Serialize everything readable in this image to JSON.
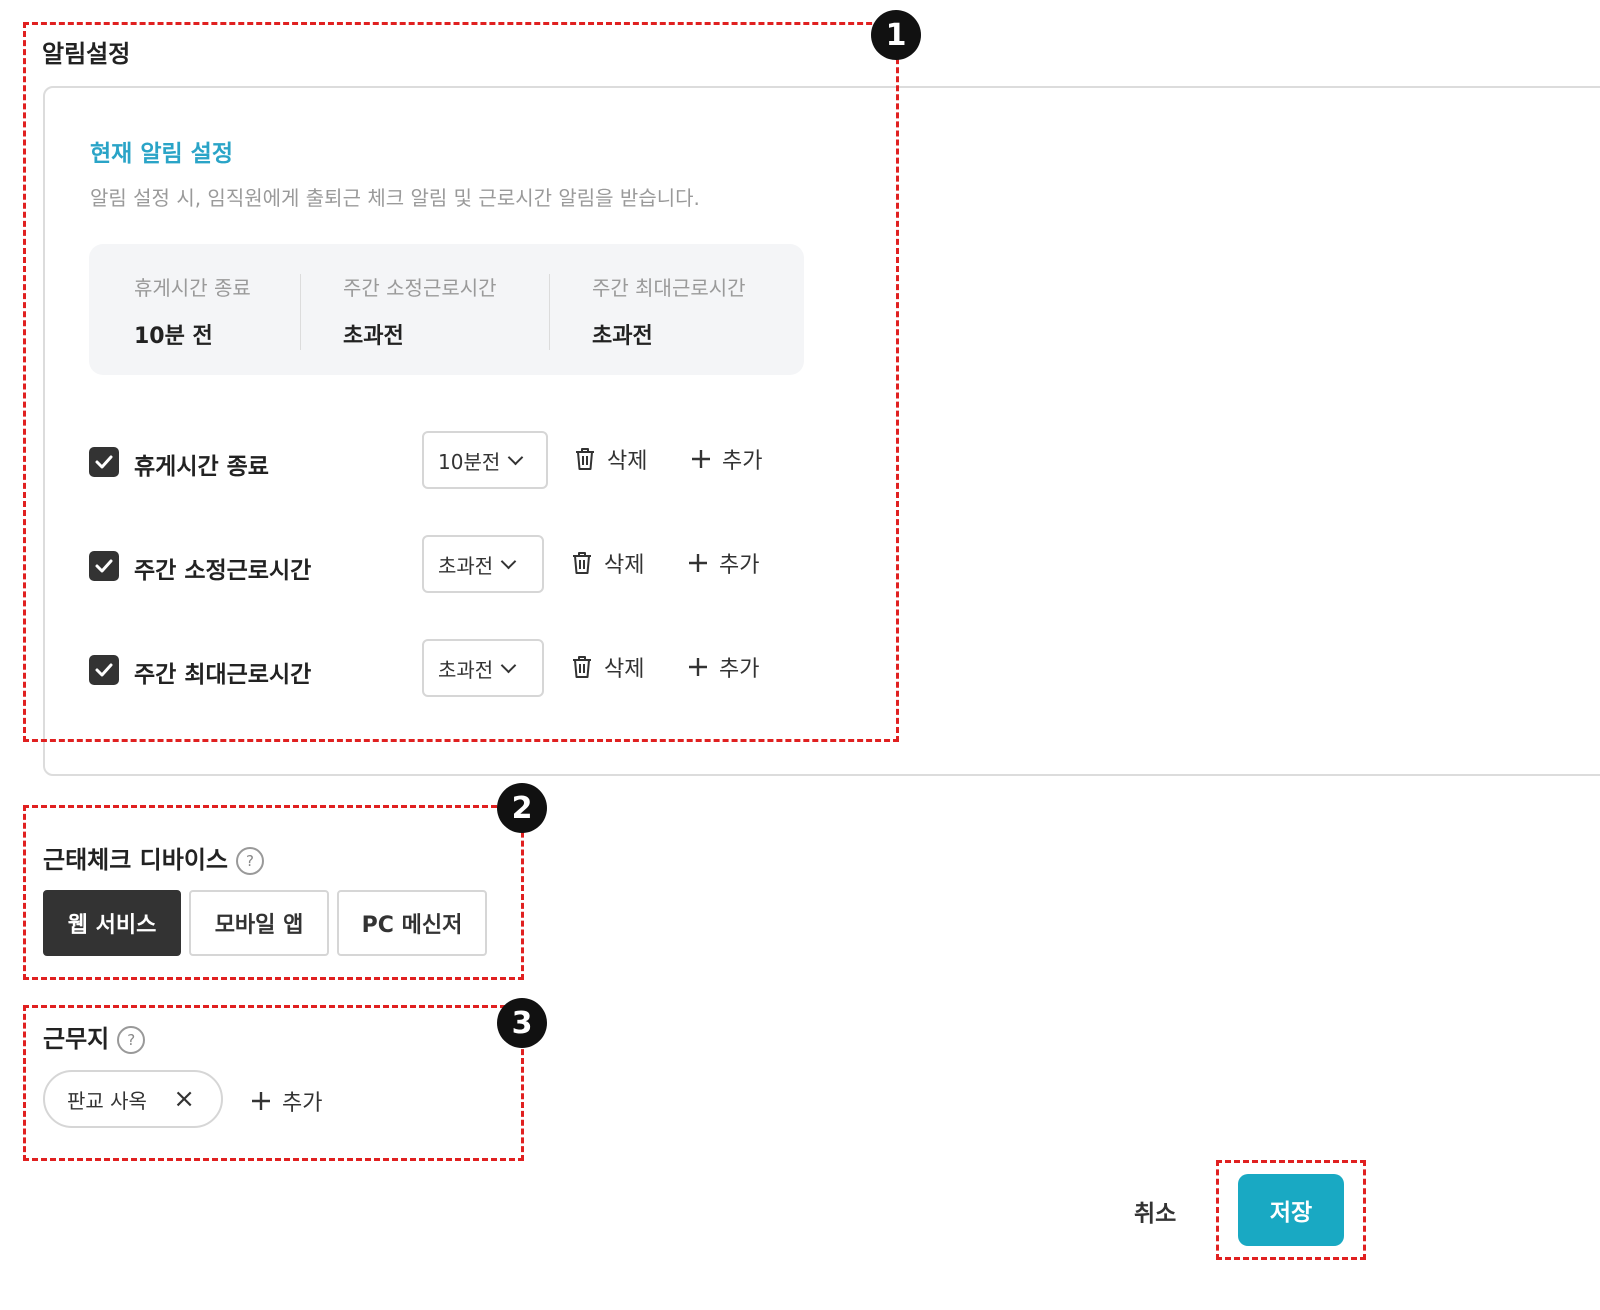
{
  "notification": {
    "title": "알림설정",
    "current_title": "현재 알림 설정",
    "current_desc": "알림 설정 시, 임직원에게 출퇴근 체크 알림 및 근로시간 알림을 받습니다.",
    "summary": [
      {
        "label": "휴게시간 종료",
        "value": "10분 전"
      },
      {
        "label": "주간 소정근로시간",
        "value": "초과전"
      },
      {
        "label": "주간 최대근로시간",
        "value": "초과전"
      }
    ],
    "rows": [
      {
        "label": "휴게시간 종료",
        "checked": true,
        "select": "10분전",
        "delete": "삭제",
        "add": "추가"
      },
      {
        "label": "주간 소정근로시간",
        "checked": true,
        "select": "초과전",
        "delete": "삭제",
        "add": "추가"
      },
      {
        "label": "주간 최대근로시간",
        "checked": true,
        "select": "초과전",
        "delete": "삭제",
        "add": "추가"
      }
    ]
  },
  "device": {
    "title": "근태체크 디바이스",
    "help": "?",
    "options": [
      {
        "label": "웹 서비스",
        "active": true
      },
      {
        "label": "모바일 앱",
        "active": false
      },
      {
        "label": "PC 메신저",
        "active": false
      }
    ]
  },
  "workplace": {
    "title": "근무지",
    "help": "?",
    "chips": [
      {
        "label": "판교 사옥",
        "remove": "×"
      }
    ],
    "add": "추가"
  },
  "footer": {
    "cancel": "취소",
    "save": "저장"
  },
  "callouts": [
    "1",
    "2",
    "3"
  ],
  "colors": {
    "accent": "#19a9c3",
    "title_accent": "#2aa4c7",
    "callout_border": "#e02020",
    "dark": "#333333"
  }
}
